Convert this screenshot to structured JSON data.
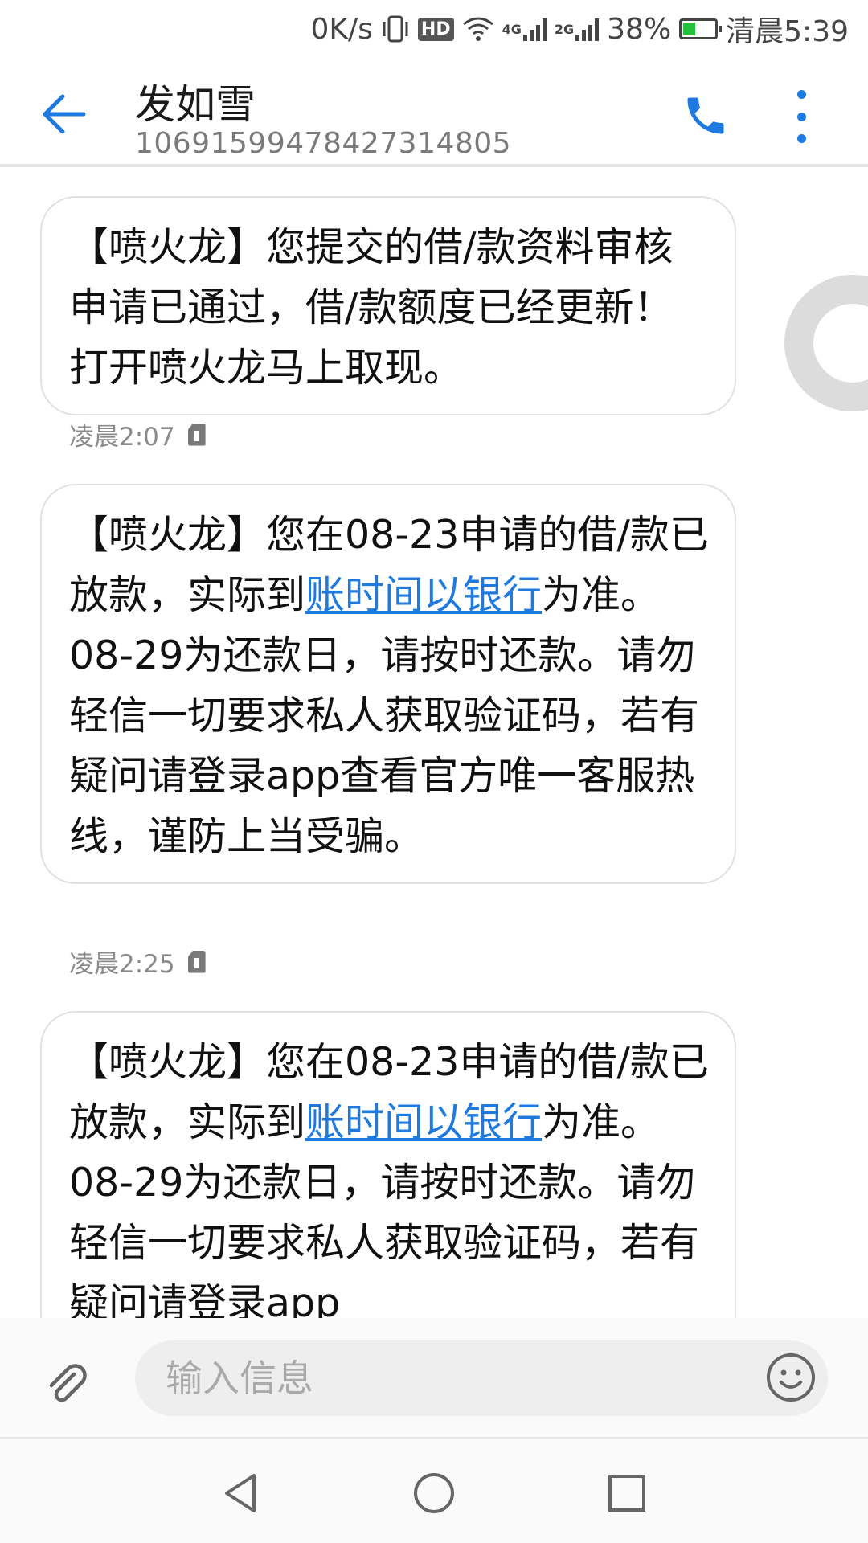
{
  "status_bar": {
    "net_speed": "0K/s",
    "hd": "HD",
    "net_4g": "4G",
    "net_2g": "2G",
    "battery_percent": "38%",
    "battery_level": 0.38,
    "time": "清晨5:39"
  },
  "header": {
    "contact_name": "发如雪",
    "contact_number": "1069159947842731480​5"
  },
  "messages": [
    {
      "text": "【喷火龙】您提交的借/款资料审核申请已通过，借/款额度已经更新！打开喷火龙马上取现。",
      "timestamp": "凌晨2:07"
    },
    {
      "text_before": "【喷火龙】您在08-23申请的借/款已放款，实际到",
      "link": "账时间以银行",
      "text_after": "为准。08-29为还款日，请按时还款。请勿轻信一切要求私人获取验证码，若有疑问请登录app查看官方唯一客服热线，谨防上当受骗。",
      "timestamp": "凌晨2:25"
    },
    {
      "text_before": "【喷火龙】您在08-23申请的借/款已放款，实际到",
      "link": "账时间以银行",
      "text_after": "为准。08-29为还款日，请按时还款。请勿轻信一切要求私人获取验证码，若有疑问请登录app"
    }
  ],
  "input": {
    "placeholder": "输入信息"
  },
  "colors": {
    "accent": "#1f7ae0",
    "bubble_border": "#e1e1e1",
    "timestamp": "#8a8a8a"
  },
  "icons": [
    "back-arrow-icon",
    "phone-icon",
    "more-vert-icon",
    "paperclip-icon",
    "emoji-icon",
    "nav-back-icon",
    "nav-home-icon",
    "nav-recents-icon",
    "sim-card-icon"
  ]
}
